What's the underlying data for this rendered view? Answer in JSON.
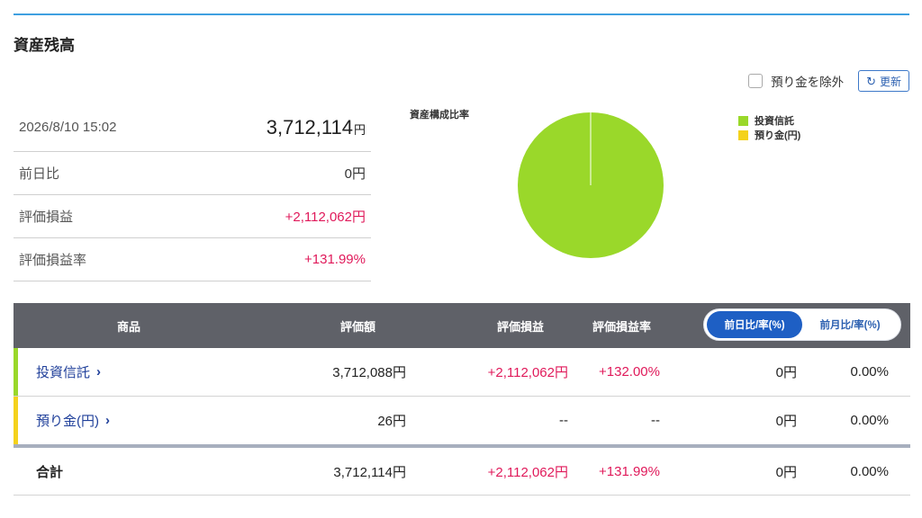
{
  "section_title": "資産残高",
  "controls": {
    "exclude_deposit_label": "預り金を除外",
    "refresh_label": "更新",
    "refresh_icon": "refresh-icon"
  },
  "summary": {
    "datetime": "2026/8/10 15:02",
    "total_value": "3,712,114",
    "total_unit": "円",
    "rows": [
      {
        "label": "前日比",
        "value": "0円"
      },
      {
        "label": "評価損益",
        "value": "+2,112,062円"
      },
      {
        "label": "評価損益率",
        "value": "+131.99%"
      }
    ]
  },
  "chart_data": {
    "type": "pie",
    "title": "資産構成比率",
    "labels": [
      "投資信託",
      "預り金(円)"
    ],
    "values": [
      3712088,
      26
    ],
    "colors": [
      "#9ad82a",
      "#f4d21c"
    ]
  },
  "holdings": {
    "headers": {
      "product": "商品",
      "valuation": "評価額",
      "pl": "評価損益",
      "pl_rate": "評価損益率"
    },
    "toggle": {
      "active": "前日比/率(%)",
      "inactive": "前月比/率(%)"
    },
    "rows": [
      {
        "name": "投資信託",
        "color": "#9ad82a",
        "valuation": "3,712,088円",
        "pl": "+2,112,062円",
        "pl_rate": "+132.00%",
        "change": "0円",
        "change_rate": "0.00%"
      },
      {
        "name": "預り金(円)",
        "color": "#f4d21c",
        "valuation": "26円",
        "pl": "--",
        "pl_rate": "--",
        "change": "0円",
        "change_rate": "0.00%"
      }
    ],
    "total": {
      "name": "合計",
      "valuation": "3,712,114円",
      "pl": "+2,112,062円",
      "pl_rate": "+131.99%",
      "change": "0円",
      "change_rate": "0.00%"
    }
  }
}
